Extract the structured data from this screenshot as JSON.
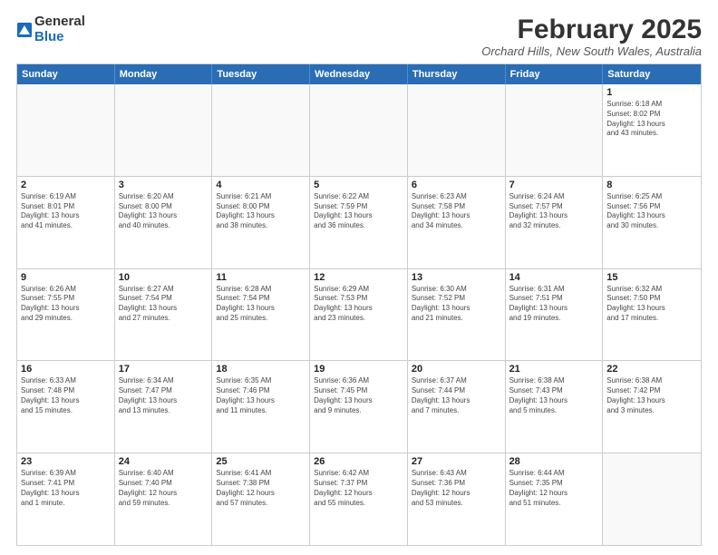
{
  "header": {
    "logo_general": "General",
    "logo_blue": "Blue",
    "month_year": "February 2025",
    "location": "Orchard Hills, New South Wales, Australia"
  },
  "weekdays": [
    "Sunday",
    "Monday",
    "Tuesday",
    "Wednesday",
    "Thursday",
    "Friday",
    "Saturday"
  ],
  "rows": [
    [
      {
        "day": "",
        "text": ""
      },
      {
        "day": "",
        "text": ""
      },
      {
        "day": "",
        "text": ""
      },
      {
        "day": "",
        "text": ""
      },
      {
        "day": "",
        "text": ""
      },
      {
        "day": "",
        "text": ""
      },
      {
        "day": "1",
        "text": "Sunrise: 6:18 AM\nSunset: 8:02 PM\nDaylight: 13 hours\nand 43 minutes."
      }
    ],
    [
      {
        "day": "2",
        "text": "Sunrise: 6:19 AM\nSunset: 8:01 PM\nDaylight: 13 hours\nand 41 minutes."
      },
      {
        "day": "3",
        "text": "Sunrise: 6:20 AM\nSunset: 8:00 PM\nDaylight: 13 hours\nand 40 minutes."
      },
      {
        "day": "4",
        "text": "Sunrise: 6:21 AM\nSunset: 8:00 PM\nDaylight: 13 hours\nand 38 minutes."
      },
      {
        "day": "5",
        "text": "Sunrise: 6:22 AM\nSunset: 7:59 PM\nDaylight: 13 hours\nand 36 minutes."
      },
      {
        "day": "6",
        "text": "Sunrise: 6:23 AM\nSunset: 7:58 PM\nDaylight: 13 hours\nand 34 minutes."
      },
      {
        "day": "7",
        "text": "Sunrise: 6:24 AM\nSunset: 7:57 PM\nDaylight: 13 hours\nand 32 minutes."
      },
      {
        "day": "8",
        "text": "Sunrise: 6:25 AM\nSunset: 7:56 PM\nDaylight: 13 hours\nand 30 minutes."
      }
    ],
    [
      {
        "day": "9",
        "text": "Sunrise: 6:26 AM\nSunset: 7:55 PM\nDaylight: 13 hours\nand 29 minutes."
      },
      {
        "day": "10",
        "text": "Sunrise: 6:27 AM\nSunset: 7:54 PM\nDaylight: 13 hours\nand 27 minutes."
      },
      {
        "day": "11",
        "text": "Sunrise: 6:28 AM\nSunset: 7:54 PM\nDaylight: 13 hours\nand 25 minutes."
      },
      {
        "day": "12",
        "text": "Sunrise: 6:29 AM\nSunset: 7:53 PM\nDaylight: 13 hours\nand 23 minutes."
      },
      {
        "day": "13",
        "text": "Sunrise: 6:30 AM\nSunset: 7:52 PM\nDaylight: 13 hours\nand 21 minutes."
      },
      {
        "day": "14",
        "text": "Sunrise: 6:31 AM\nSunset: 7:51 PM\nDaylight: 13 hours\nand 19 minutes."
      },
      {
        "day": "15",
        "text": "Sunrise: 6:32 AM\nSunset: 7:50 PM\nDaylight: 13 hours\nand 17 minutes."
      }
    ],
    [
      {
        "day": "16",
        "text": "Sunrise: 6:33 AM\nSunset: 7:48 PM\nDaylight: 13 hours\nand 15 minutes."
      },
      {
        "day": "17",
        "text": "Sunrise: 6:34 AM\nSunset: 7:47 PM\nDaylight: 13 hours\nand 13 minutes."
      },
      {
        "day": "18",
        "text": "Sunrise: 6:35 AM\nSunset: 7:46 PM\nDaylight: 13 hours\nand 11 minutes."
      },
      {
        "day": "19",
        "text": "Sunrise: 6:36 AM\nSunset: 7:45 PM\nDaylight: 13 hours\nand 9 minutes."
      },
      {
        "day": "20",
        "text": "Sunrise: 6:37 AM\nSunset: 7:44 PM\nDaylight: 13 hours\nand 7 minutes."
      },
      {
        "day": "21",
        "text": "Sunrise: 6:38 AM\nSunset: 7:43 PM\nDaylight: 13 hours\nand 5 minutes."
      },
      {
        "day": "22",
        "text": "Sunrise: 6:38 AM\nSunset: 7:42 PM\nDaylight: 13 hours\nand 3 minutes."
      }
    ],
    [
      {
        "day": "23",
        "text": "Sunrise: 6:39 AM\nSunset: 7:41 PM\nDaylight: 13 hours\nand 1 minute."
      },
      {
        "day": "24",
        "text": "Sunrise: 6:40 AM\nSunset: 7:40 PM\nDaylight: 12 hours\nand 59 minutes."
      },
      {
        "day": "25",
        "text": "Sunrise: 6:41 AM\nSunset: 7:38 PM\nDaylight: 12 hours\nand 57 minutes."
      },
      {
        "day": "26",
        "text": "Sunrise: 6:42 AM\nSunset: 7:37 PM\nDaylight: 12 hours\nand 55 minutes."
      },
      {
        "day": "27",
        "text": "Sunrise: 6:43 AM\nSunset: 7:36 PM\nDaylight: 12 hours\nand 53 minutes."
      },
      {
        "day": "28",
        "text": "Sunrise: 6:44 AM\nSunset: 7:35 PM\nDaylight: 12 hours\nand 51 minutes."
      },
      {
        "day": "",
        "text": ""
      }
    ]
  ]
}
